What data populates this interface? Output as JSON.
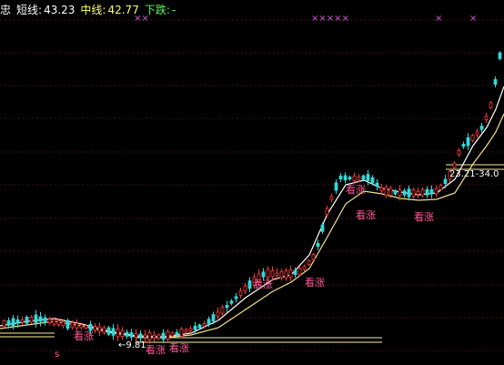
{
  "header": {
    "indicator_name": "忠",
    "short_line_label": "短线:",
    "short_line_value": "43.23",
    "mid_line_label": "中线:",
    "mid_line_value": "42.77",
    "trend_label": "下跌:",
    "trend_value": "-"
  },
  "colors": {
    "background": "#000000",
    "up_candle": "#ff3b3b",
    "down_candle": "#35d8d8",
    "short_line": "#ffffff",
    "mid_line": "#f1e28a",
    "signal_text": "#ff5c9a",
    "marker": "#d85ce0",
    "support": "#f7ef9a",
    "grid": "#9b1a1a",
    "header_text": "#ffffff",
    "mid_text": "#ffff66",
    "trend_text": "#52ff52"
  },
  "signals": [
    {
      "text": "看涨"
    },
    {
      "text": "看涨"
    },
    {
      "text": "看涨"
    },
    {
      "text": "看涨"
    },
    {
      "text": "看涨"
    },
    {
      "text": "看涨"
    },
    {
      "text": "看涨"
    },
    {
      "text": "看涨"
    }
  ],
  "annotations": {
    "range_label": "23.21-34.0",
    "low_price_label": "←9.81",
    "bottom_marker": "s"
  },
  "chart_data": {
    "type": "candlestick",
    "series": [
      {
        "name": "短线",
        "last": 43.23
      },
      {
        "name": "中线",
        "last": 42.77
      }
    ],
    "top_markers": [
      "××",
      "×××××",
      "×",
      "×"
    ]
  }
}
